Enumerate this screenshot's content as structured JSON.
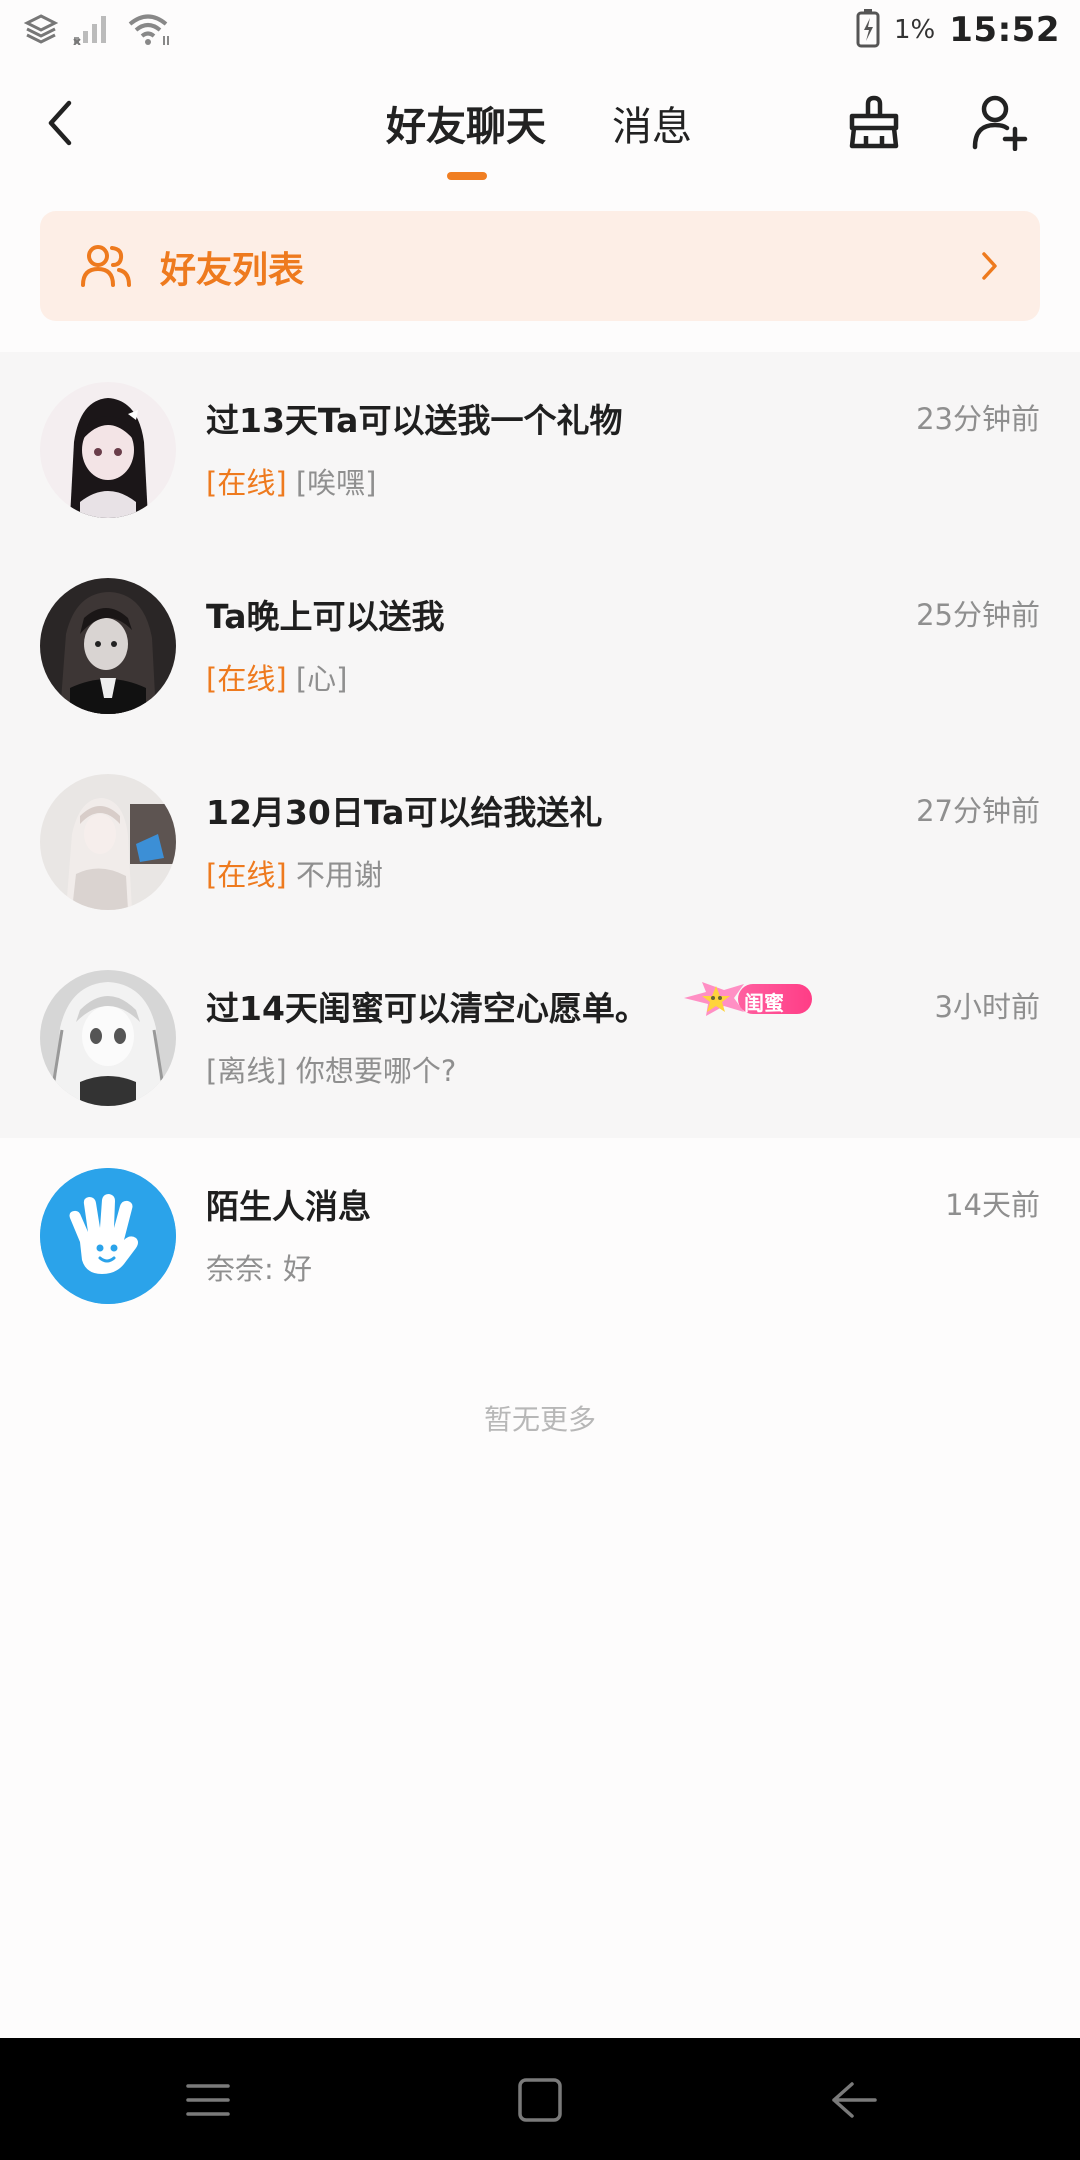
{
  "status_bar": {
    "battery_percent": "1%",
    "time": "15:52"
  },
  "header": {
    "tabs": [
      {
        "label": "好友聊天",
        "active": true
      },
      {
        "label": "消息",
        "active": false
      }
    ]
  },
  "friends_banner": {
    "label": "好友列表"
  },
  "conversations": [
    {
      "title": "过13天Ta可以送我一个礼物",
      "time": "23分钟前",
      "status": "[在线]",
      "online": true,
      "preview": "[唉嘿]"
    },
    {
      "title": "Ta晚上可以送我",
      "time": "25分钟前",
      "status": "[在线]",
      "online": true,
      "preview": "[心]"
    },
    {
      "title": "12月30日Ta可以给我送礼",
      "time": "27分钟前",
      "status": "[在线]",
      "online": true,
      "preview": "不用谢"
    },
    {
      "title": "过14天闺蜜可以清空心愿单。",
      "time": "3小时前",
      "status": "[离线]",
      "online": false,
      "preview": "你想要哪个?",
      "badge": "闺蜜"
    }
  ],
  "stranger": {
    "title": "陌生人消息",
    "time": "14天前",
    "preview": "奈奈: 好"
  },
  "footer": {
    "no_more": "暂无更多"
  },
  "colors": {
    "accent": "#ee7a1e",
    "banner_bg": "#fdeee6",
    "section_bg": "#f7f6f6",
    "stranger_avatar": "#2ba3ea",
    "badge": "#ff4f93"
  }
}
